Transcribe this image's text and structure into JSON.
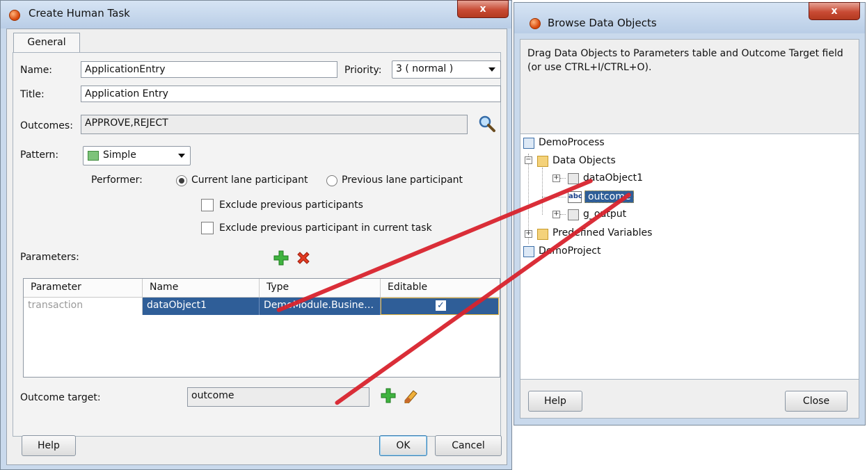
{
  "left_dialog": {
    "title": "Create Human Task",
    "close_label": "x",
    "tab": "General",
    "name_label": "Name:",
    "name_value": "ApplicationEntry",
    "priority_label": "Priority:",
    "priority_value": "3 ( normal )",
    "title_label": "Title:",
    "title_value": "Application Entry",
    "outcomes_label": "Outcomes:",
    "outcomes_value": "APPROVE,REJECT",
    "pattern_label": "Pattern:",
    "pattern_value": "Simple",
    "performer_label": "Performer:",
    "radio_current": "Current lane participant",
    "radio_previous": "Previous lane participant",
    "check_exclude_prev": "Exclude previous participants",
    "check_exclude_current": "Exclude previous participant in current task",
    "parameters_label": "Parameters:",
    "table": {
      "headers": [
        "Parameter",
        "Name",
        "Type",
        "Editable"
      ],
      "row": {
        "parameter": "transaction",
        "name": "dataObject1",
        "type": "DemoModule.Busine…",
        "editable": "✓"
      }
    },
    "outcome_target_label": "Outcome target:",
    "outcome_target_value": "outcome",
    "help": "Help",
    "ok": "OK",
    "cancel": "Cancel"
  },
  "right_dialog": {
    "title": "Browse Data Objects",
    "close_label": "x",
    "instructions": "Drag Data Objects to Parameters table and Outcome Target field (or use CTRL+I/CTRL+O).",
    "tree": {
      "root": "DemoProcess",
      "data_objects": "Data Objects",
      "item1": "dataObject1",
      "item2": "outcome",
      "item3": "g_output",
      "predefined": "Predefined Variables",
      "project": "DemoProject"
    },
    "abc_label": "abc",
    "help": "Help",
    "close": "Close"
  },
  "colors": {
    "accent_red": "#d8232d",
    "selection": "#2f5e98"
  }
}
